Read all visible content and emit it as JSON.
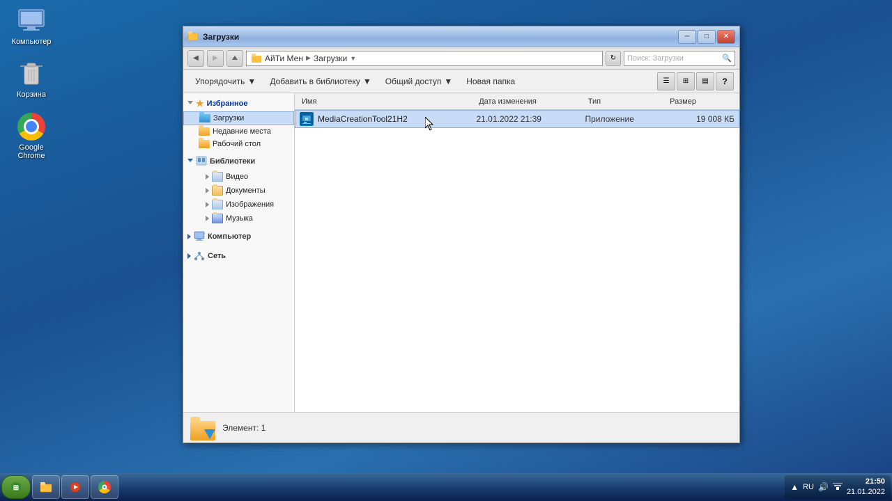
{
  "desktop": {
    "icons": [
      {
        "id": "computer",
        "label": "Компьютер"
      },
      {
        "id": "trash",
        "label": "Корзина"
      },
      {
        "id": "chrome",
        "label": "Google Chrome"
      }
    ]
  },
  "window": {
    "title": "Загрузки",
    "address": {
      "parts": [
        "АйТи Мен",
        "Загрузки"
      ],
      "search_placeholder": "Поиск: Загрузки"
    },
    "toolbar": {
      "sort_label": "Упорядочить",
      "add_library_label": "Добавить в библиотеку",
      "share_label": "Общий доступ",
      "new_folder_label": "Новая папка"
    },
    "columns": {
      "name": "Имя",
      "date": "Дата изменения",
      "type": "Тип",
      "size": "Размер"
    },
    "files": [
      {
        "name": "MediaCreationTool21H2",
        "date": "21.01.2022 21:39",
        "type": "Приложение",
        "size": "19 008 КБ"
      }
    ],
    "status": {
      "text": "Элемент: 1"
    }
  },
  "sidebar": {
    "favorites_label": "Избранное",
    "downloads_label": "Загрузки",
    "recent_label": "Недавние места",
    "desktop_label": "Рабочий стол",
    "libraries_label": "Библиотеки",
    "video_label": "Видео",
    "documents_label": "Документы",
    "images_label": "Изображения",
    "music_label": "Музыка",
    "computer_label": "Компьютер",
    "network_label": "Сеть"
  },
  "taskbar": {
    "start_label": "",
    "clock": {
      "time": "21:50",
      "date": "21.01.2022"
    },
    "tray": {
      "lang": "RU"
    }
  }
}
